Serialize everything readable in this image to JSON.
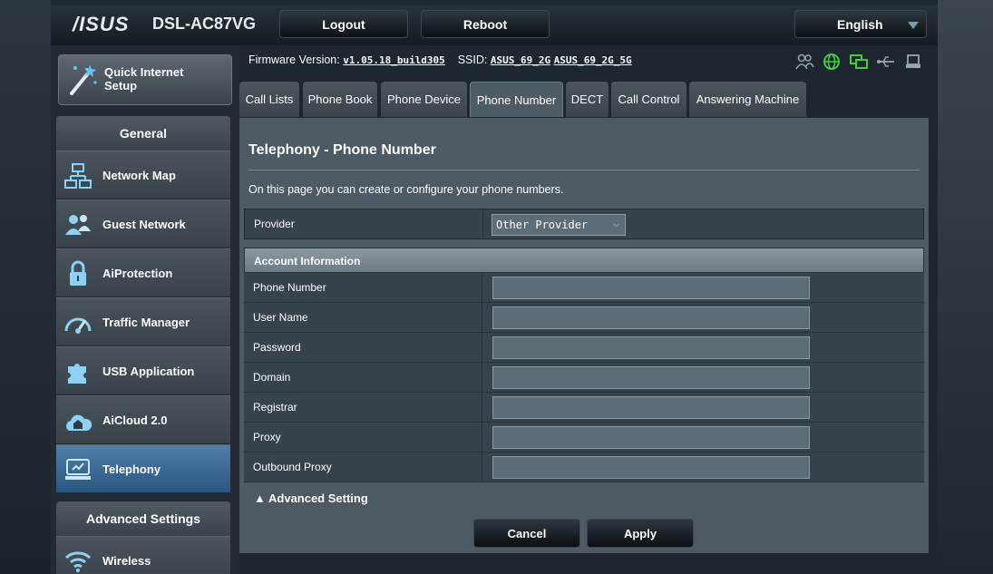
{
  "header": {
    "brand": "/ISUS",
    "model": "DSL-AC87VG",
    "logout_label": "Logout",
    "reboot_label": "Reboot",
    "language": "English"
  },
  "sidebar": {
    "quick_setup": "Quick Internet Setup",
    "general_title": "General",
    "items": [
      {
        "label": "Network Map",
        "icon": "network-map-icon"
      },
      {
        "label": "Guest Network",
        "icon": "guest-network-icon"
      },
      {
        "label": "AiProtection",
        "icon": "lock-icon"
      },
      {
        "label": "Traffic Manager",
        "icon": "gauge-icon"
      },
      {
        "label": "USB Application",
        "icon": "puzzle-icon"
      },
      {
        "label": "AiCloud 2.0",
        "icon": "cloud-house-icon"
      },
      {
        "label": "Telephony",
        "icon": "telephony-icon"
      }
    ],
    "advanced_title": "Advanced Settings",
    "advanced_items": [
      {
        "label": "Wireless",
        "icon": "wifi-icon"
      }
    ]
  },
  "status": {
    "firmware_label": "Firmware Version:",
    "firmware_value": "v1.05.18_build305",
    "ssid_label": "SSID:",
    "ssid_2g": "ASUS_69_2G",
    "ssid_5g": "ASUS_69_2G_5G"
  },
  "tabs": [
    "Call Lists",
    "Phone Book",
    "Phone Device",
    "Phone Number",
    "DECT",
    "Call Control",
    "Answering Machine"
  ],
  "main": {
    "title": "Telephony - Phone Number",
    "description": "On this page you can create or configure your phone numbers.",
    "provider_label": "Provider",
    "provider_value": "Other Provider",
    "account_header": "Account Information",
    "fields": [
      {
        "label": "Phone Number",
        "value": ""
      },
      {
        "label": "User Name",
        "value": ""
      },
      {
        "label": "Password",
        "value": ""
      },
      {
        "label": "Domain",
        "value": ""
      },
      {
        "label": "Registrar",
        "value": ""
      },
      {
        "label": "Proxy",
        "value": ""
      },
      {
        "label": "Outbound Proxy",
        "value": ""
      }
    ],
    "advanced_setting": "▲ Advanced Setting",
    "cancel_label": "Cancel",
    "apply_label": "Apply"
  }
}
